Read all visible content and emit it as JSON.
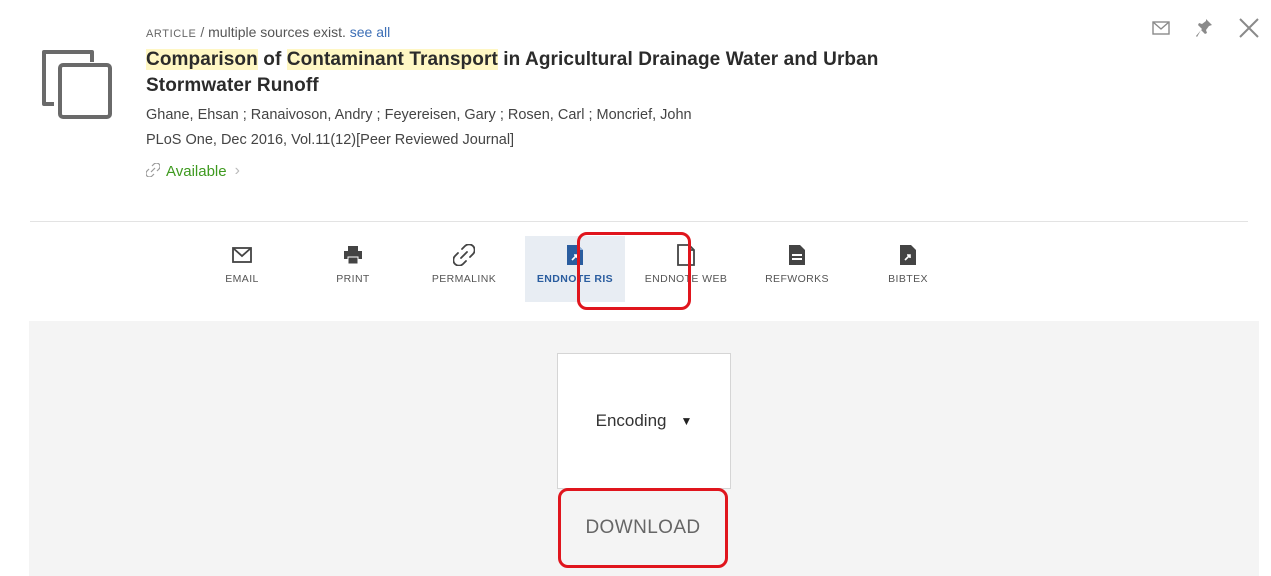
{
  "record": {
    "type_label": "ARTICLE",
    "separator": "/",
    "source_note": "multiple sources exist.",
    "see_all_link": "see all",
    "title_part1": "Comparison",
    "title_part2": " of ",
    "title_part3": "Contaminant Transport",
    "title_part4": " in Agricultural Drainage Water and Urban Stormwater Runoff",
    "authors": "Ghane, Ehsan ; Ranaivoson, Andry ; Feyereisen, Gary ; Rosen, Carl ; Moncrief, John",
    "source": "PLoS One, Dec 2016, Vol.11(12)[Peer Reviewed Journal]",
    "availability": "Available",
    "icon": "multiple-versions-icon"
  },
  "top_actions": [
    {
      "name": "email-icon"
    },
    {
      "name": "pin-icon"
    },
    {
      "name": "close-icon"
    }
  ],
  "actions": [
    {
      "label": "EMAIL",
      "icon": "envelope-icon"
    },
    {
      "label": "PRINT",
      "icon": "printer-icon"
    },
    {
      "label": "PERMALINK",
      "icon": "link-icon"
    },
    {
      "label": "ENDNOTE RIS",
      "icon": "endnote-ris-icon",
      "selected": true
    },
    {
      "label": "ENDNOTE WEB",
      "icon": "document-icon"
    },
    {
      "label": "REFWORKS",
      "icon": "refworks-icon"
    },
    {
      "label": "BIBTEX",
      "icon": "bibtex-icon"
    }
  ],
  "export_panel": {
    "encoding_label": "Encoding",
    "download_label": "DOWNLOAD"
  },
  "colors": {
    "highlight_box": "#e0151d",
    "available_green": "#3e9a1f",
    "selected_bg": "#e8edf3",
    "link_blue": "#3d6fb6"
  }
}
